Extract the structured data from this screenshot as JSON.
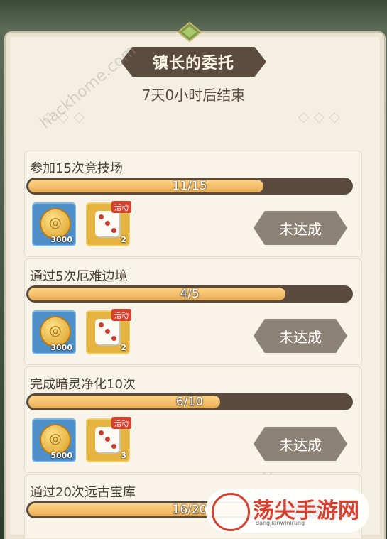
{
  "dialog": {
    "title": "镇长的委托",
    "countdown": "7天0小时后结束"
  },
  "status_label": "未达成",
  "event_tag": "活动",
  "tasks": [
    {
      "title": "参加15次竞技场",
      "progress": "11/15",
      "fraction": 0.733,
      "coin_qty": "3000",
      "dice_qty": "2"
    },
    {
      "title": "通过5次厄难边境",
      "progress": "4/5",
      "fraction": 0.8,
      "coin_qty": "3000",
      "dice_qty": "2"
    },
    {
      "title": "完成暗灵净化10次",
      "progress": "6/10",
      "fraction": 0.6,
      "coin_qty": "5000",
      "dice_qty": "3"
    },
    {
      "title": "通过20次远古宝库",
      "progress": "16/20",
      "fraction": 0.8
    }
  ],
  "watermarks": {
    "site": "hackhome.com",
    "logo_text": "荡尖手游网",
    "logo_sub": "dangjianwinirung"
  },
  "colors": {
    "accent": "#e8ad55",
    "panel": "#f4efe2",
    "button": "#8d8276",
    "tag": "#d6402f"
  }
}
